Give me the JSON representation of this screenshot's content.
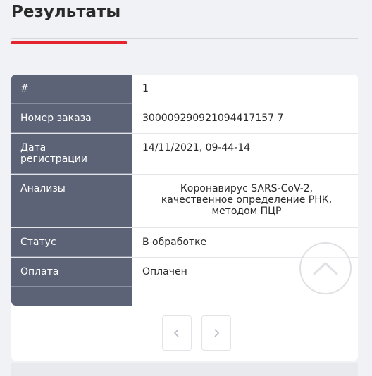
{
  "page": {
    "title": "Результаты"
  },
  "order": {
    "rows": [
      {
        "label": "#",
        "value": "1"
      },
      {
        "label": "Номер заказа",
        "value": "300009290921094417157 7"
      },
      {
        "label": "Дата\nрегистрации",
        "value": "14/11/2021, 09-44-14"
      },
      {
        "label": "Анализы",
        "value": "Коронавирус SARS-CoV-2, качественное определение РНК, методом ПЦР"
      },
      {
        "label": "Статус",
        "value": "В обработке"
      },
      {
        "label": "Оплата",
        "value": "Оплачен"
      },
      {
        "label": "",
        "value": ""
      }
    ]
  },
  "pager": {
    "prev_icon": "chevron-left-icon",
    "next_icon": "chevron-right-icon"
  },
  "scroll_top": {
    "icon": "chevron-up-icon"
  },
  "colors": {
    "accent": "#e3262d",
    "label_bg": "#5d6376"
  }
}
